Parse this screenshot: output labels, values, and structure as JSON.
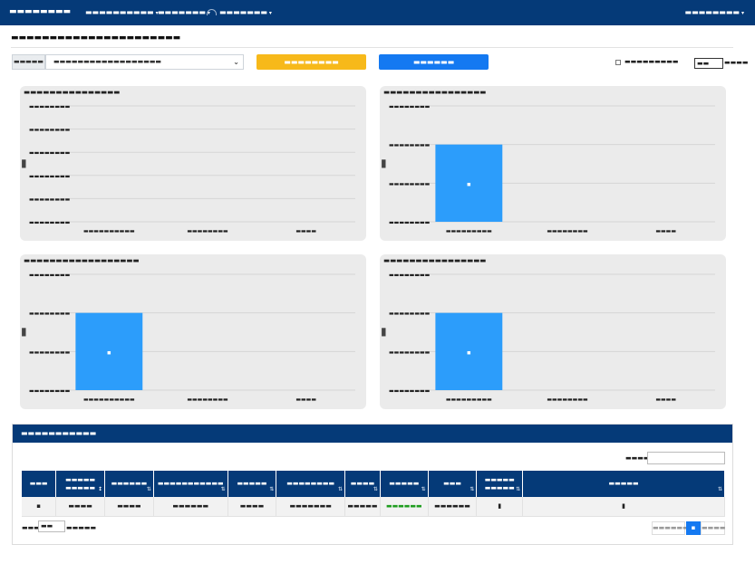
{
  "navbar": {
    "brand": "▬▬▬▬▬▬▬▬",
    "menu1": "▬▬▬▬▬▬▬▬▬▬",
    "menu2": "▬▬▬▬▬▬▬",
    "user": "▬▬▬▬▬▬▬",
    "right": "▬▬▬▬▬▬▬▬"
  },
  "page": {
    "title": "▬▬▬▬▬▬▬▬▬▬▬▬▬▬▬▬▬▬▬▬▬▬"
  },
  "toolbar": {
    "select_label": "▬▬▬▬▬",
    "select_value": "▬▬▬▬▬▬▬▬▬▬▬▬▬▬▬▬▬▬",
    "warning_button": "▬▬▬▬▬▬▬▬",
    "primary_button": "▬▬▬▬▬▬",
    "checkbox_label": "▬▬▬▬▬▬▬▬▬",
    "refresh_value": "▬▬",
    "refresh_label": "▬▬▬▬"
  },
  "chart_data": [
    {
      "type": "bar",
      "title": "▬▬▬▬▬▬▬▬▬▬▬▬▬▬▬",
      "ylabel": "▮",
      "categories": [
        "▬▬▬▬▬▬▬▬▬▬",
        "▬▬▬▬▬▬▬▬",
        "▬▬▬▬"
      ],
      "y_ticks": [
        "▬▬▬▬▬▬▬▬",
        "▬▬▬▬▬▬▬▬",
        "▬▬▬▬▬▬▬▬",
        "▬▬▬▬▬▬▬▬",
        "▬▬▬▬▬▬▬▬",
        "▬▬▬▬▬▬▬▬"
      ],
      "values": [
        0,
        0,
        0
      ],
      "ylim": [
        0,
        1
      ],
      "data_labels": [
        "",
        "",
        ""
      ],
      "bar_color": "#2c9dfb",
      "grid": true
    },
    {
      "type": "bar",
      "title": "▬▬▬▬▬▬▬▬▬▬▬▬▬▬▬▬",
      "ylabel": "▮",
      "categories": [
        "▬▬▬▬▬▬▬▬▬",
        "▬▬▬▬▬▬▬▬",
        "▬▬▬▬"
      ],
      "y_ticks": [
        "▬▬▬▬▬▬▬▬",
        "▬▬▬▬▬▬▬▬",
        "▬▬▬▬▬▬▬▬",
        "▬▬▬▬▬▬▬▬"
      ],
      "values": [
        2,
        0,
        0
      ],
      "ylim": [
        0,
        3
      ],
      "data_labels": [
        "▪",
        "",
        ""
      ],
      "bar_color": "#2c9dfb",
      "grid": true
    },
    {
      "type": "bar",
      "title": "▬▬▬▬▬▬▬▬▬▬▬▬▬▬▬▬▬▬",
      "ylabel": "▮",
      "categories": [
        "▬▬▬▬▬▬▬▬▬▬",
        "▬▬▬▬▬▬▬▬",
        "▬▬▬▬"
      ],
      "y_ticks": [
        "▬▬▬▬▬▬▬▬",
        "▬▬▬▬▬▬▬▬",
        "▬▬▬▬▬▬▬▬",
        "▬▬▬▬▬▬▬▬"
      ],
      "values": [
        2,
        0,
        0
      ],
      "ylim": [
        0,
        3
      ],
      "data_labels": [
        "▪",
        "",
        ""
      ],
      "bar_color": "#2c9dfb",
      "grid": true
    },
    {
      "type": "bar",
      "title": "▬▬▬▬▬▬▬▬▬▬▬▬▬▬▬▬",
      "ylabel": "▮",
      "categories": [
        "▬▬▬▬▬▬▬▬▬",
        "▬▬▬▬▬▬▬▬",
        "▬▬▬▬"
      ],
      "y_ticks": [
        "▬▬▬▬▬▬▬▬",
        "▬▬▬▬▬▬▬▬",
        "▬▬▬▬▬▬▬▬",
        "▬▬▬▬▬▬▬▬"
      ],
      "values": [
        2,
        0,
        0
      ],
      "ylim": [
        0,
        3
      ],
      "data_labels": [
        "▪",
        "",
        ""
      ],
      "bar_color": "#2c9dfb",
      "grid": true
    }
  ],
  "table_panel": {
    "title": "▬▬▬▬▬▬▬▬▬▬▬",
    "search_label": "▬▬▬▬",
    "columns": [
      {
        "label": "▬▬▬",
        "sort": "none"
      },
      {
        "label": "▬▬▬▬▬ ▬▬▬▬▬",
        "sort": "active"
      },
      {
        "label": "▬▬▬▬▬▬",
        "sort": "none"
      },
      {
        "label": "▬▬▬▬▬▬▬▬▬▬▬",
        "sort": "none"
      },
      {
        "label": "▬▬▬▬▬",
        "sort": "none"
      },
      {
        "label": "▬▬▬▬▬▬▬▬",
        "sort": "none"
      },
      {
        "label": "▬▬▬▬",
        "sort": "none"
      },
      {
        "label": "▬▬▬▬▬",
        "sort": "none"
      },
      {
        "label": "▬▬▬",
        "sort": "none"
      },
      {
        "label": "▬▬▬▬▬ ▬▬▬▬▬",
        "sort": "none"
      },
      {
        "label": "▬▬▬▬▬",
        "sort": "none"
      }
    ],
    "rows": [
      [
        "▪",
        "▬▬▬▬",
        "▬▬▬▬",
        "▬▬▬▬▬▬",
        "▬▬▬▬",
        "▬▬▬▬▬▬▬",
        "▬▬▬▬▬",
        "▬▬▬▬▬▬",
        "▬▬▬▬▬▬",
        "▮",
        "▮"
      ]
    ],
    "status_color": "#1f9d1f",
    "show_label": "▬▬▬",
    "page_length": "▬▬",
    "entries_label": "▬▬▬▬▬",
    "pagination": {
      "prev": "▬▬▬▬▬▬",
      "current": "▪",
      "next": "▬▬▬▬"
    }
  },
  "colors": {
    "navbar": "#053a78",
    "warning": "#f7b91a",
    "primary": "#1479f1",
    "card_bg": "#ebebeb",
    "bar": "#2c9dfb"
  },
  "icons": {
    "user": "user-icon",
    "caret": "caret-down-icon",
    "sort": "sort-icon",
    "select_arrow": "chevron-down-icon"
  }
}
